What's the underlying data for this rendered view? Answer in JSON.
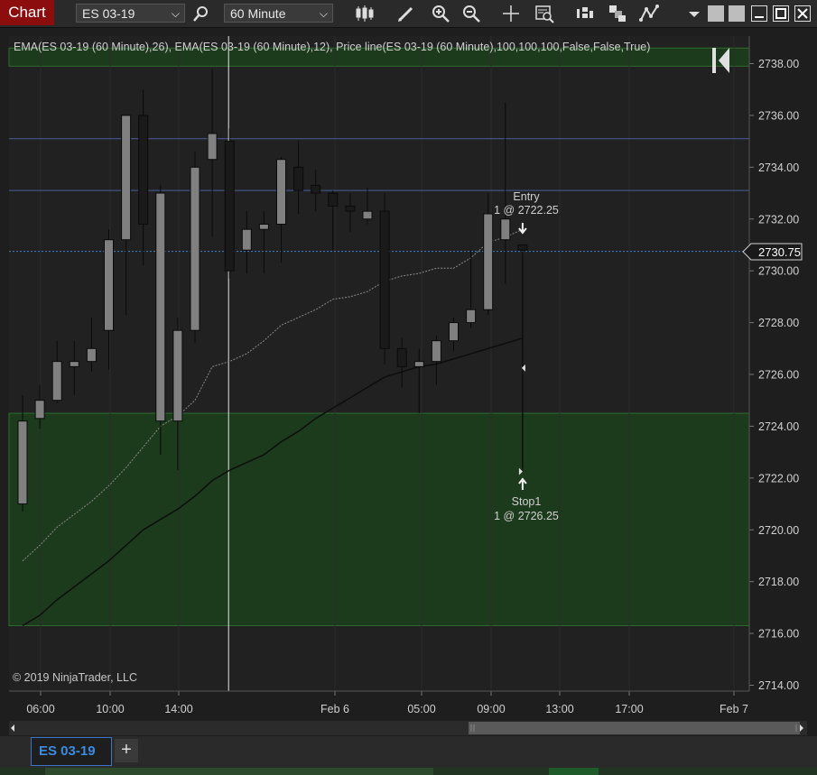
{
  "toolbar": {
    "title": "Chart",
    "instrument": "ES 03-19",
    "timeframe": "60 Minute"
  },
  "indicator_label": "EMA(ES 03-19 (60 Minute),26), EMA(ES 03-19 (60 Minute),12), Price line(ES 03-19 (60 Minute),100,100,100,False,False,True)",
  "copyright": "© 2019 NinjaTrader, LLC",
  "price_axis": {
    "ticks": [
      "2738.00",
      "2736.00",
      "2734.00",
      "2732.00",
      "2730.00",
      "2728.00",
      "2726.00",
      "2724.00",
      "2722.00",
      "2720.00",
      "2718.00",
      "2716.00",
      "2714.00"
    ],
    "current_price": "2730.75"
  },
  "time_axis": {
    "ticks": [
      "06:00",
      "10:00",
      "14:00",
      "Feb 6",
      "05:00",
      "09:00",
      "13:00",
      "17:00",
      "Feb 7"
    ]
  },
  "orders": {
    "entry_name": "Entry",
    "entry_detail": "1 @ 2722.25",
    "stop_name": "Stop1",
    "stop_detail": "1 @ 2726.25"
  },
  "tabs": {
    "active": "ES 03-19",
    "add": "+"
  },
  "colors": {
    "title_bg": "#8b0d0d",
    "up_candle": "#808080",
    "down_candle": "#1a1a1a",
    "zone": "#1c3a1c",
    "hline": "#4a5fa0",
    "price_line": "#3b82c4",
    "tab_accent": "#3b8be0"
  },
  "chart_data": {
    "type": "candlestick",
    "instrument": "ES 03-19",
    "interval": "60 Minute",
    "candles": [
      {
        "o": 2721.0,
        "h": 2725.2,
        "l": 2720.7,
        "c": 2724.2
      },
      {
        "o": 2724.3,
        "h": 2725.6,
        "l": 2723.9,
        "c": 2725.0
      },
      {
        "o": 2725.0,
        "h": 2727.3,
        "l": 2724.9,
        "c": 2726.5
      },
      {
        "o": 2726.3,
        "h": 2727.3,
        "l": 2725.2,
        "c": 2726.5
      },
      {
        "o": 2726.5,
        "h": 2728.2,
        "l": 2726.1,
        "c": 2727.0
      },
      {
        "o": 2727.7,
        "h": 2731.6,
        "l": 2726.2,
        "c": 2731.2
      },
      {
        "o": 2731.2,
        "h": 2736.0,
        "l": 2728.3,
        "c": 2736.0
      },
      {
        "o": 2736.0,
        "h": 2737.0,
        "l": 2730.2,
        "c": 2731.8
      },
      {
        "o": 2724.2,
        "h": 2733.3,
        "l": 2722.9,
        "c": 2733.0
      },
      {
        "o": 2724.2,
        "h": 2728.2,
        "l": 2722.3,
        "c": 2727.7
      },
      {
        "o": 2727.7,
        "h": 2734.6,
        "l": 2727.2,
        "c": 2734.0
      },
      {
        "o": 2734.3,
        "h": 2737.8,
        "l": 2731.3,
        "c": 2735.3
      },
      {
        "o": 2735.0,
        "h": 2735.5,
        "l": 2729.7,
        "c": 2730.0
      },
      {
        "o": 2730.8,
        "h": 2732.3,
        "l": 2729.9,
        "c": 2731.6
      },
      {
        "o": 2731.6,
        "h": 2732.3,
        "l": 2729.9,
        "c": 2731.8
      },
      {
        "o": 2731.8,
        "h": 2734.4,
        "l": 2730.3,
        "c": 2734.3
      },
      {
        "o": 2734.0,
        "h": 2735.0,
        "l": 2732.2,
        "c": 2733.1
      },
      {
        "o": 2733.3,
        "h": 2733.9,
        "l": 2732.3,
        "c": 2733.0
      },
      {
        "o": 2733.0,
        "h": 2733.1,
        "l": 2730.8,
        "c": 2732.5
      },
      {
        "o": 2732.5,
        "h": 2733.0,
        "l": 2731.5,
        "c": 2732.3
      },
      {
        "o": 2732.0,
        "h": 2733.2,
        "l": 2731.8,
        "c": 2732.3
      },
      {
        "o": 2732.3,
        "h": 2733.0,
        "l": 2726.4,
        "c": 2727.0
      },
      {
        "o": 2727.0,
        "h": 2727.4,
        "l": 2725.5,
        "c": 2726.3
      },
      {
        "o": 2726.3,
        "h": 2727.0,
        "l": 2724.5,
        "c": 2726.5
      },
      {
        "o": 2726.5,
        "h": 2727.5,
        "l": 2725.6,
        "c": 2727.3
      },
      {
        "o": 2727.3,
        "h": 2728.2,
        "l": 2726.9,
        "c": 2728.0
      },
      {
        "o": 2728.0,
        "h": 2730.8,
        "l": 2727.8,
        "c": 2728.5
      },
      {
        "o": 2728.5,
        "h": 2733.0,
        "l": 2728.3,
        "c": 2732.2
      },
      {
        "o": 2731.2,
        "h": 2736.5,
        "l": 2729.5,
        "c": 2732.0
      },
      {
        "o": 2731.0,
        "h": 2731.0,
        "l": 2722.3,
        "c": 2730.8
      }
    ],
    "ema26": [
      2716.3,
      2716.7,
      2717.3,
      2717.8,
      2718.3,
      2718.8,
      2719.4,
      2720.0,
      2720.4,
      2720.8,
      2721.3,
      2721.9,
      2722.3,
      2722.6,
      2722.9,
      2723.4,
      2723.8,
      2724.3,
      2724.7,
      2725.1,
      2725.5,
      2725.9,
      2726.1,
      2726.3,
      2726.4,
      2726.6,
      2726.8,
      2727.0,
      2727.2,
      2727.4
    ],
    "ema12": [
      2718.8,
      2719.4,
      2720.1,
      2720.6,
      2721.1,
      2721.7,
      2722.4,
      2723.2,
      2724.0,
      2724.4,
      2725.0,
      2726.3,
      2726.5,
      2726.8,
      2727.3,
      2727.9,
      2728.2,
      2728.5,
      2728.9,
      2729.0,
      2729.2,
      2729.6,
      2729.8,
      2729.9,
      2730.1,
      2730.1,
      2730.5,
      2731.1,
      2731.3,
      2731.6
    ],
    "price_axis_range": [
      2714.0,
      2738.5
    ],
    "horizontal_lines": [
      2735.1,
      2733.1
    ],
    "price_line": 2730.75,
    "zones": [
      {
        "from": 2716.3,
        "to": 2724.5
      },
      {
        "from": 2737.9,
        "to": 2739.0
      }
    ],
    "vertical_line_index": 12,
    "order_markers": [
      {
        "label": "Entry",
        "quantity": 1,
        "price": 2722.25,
        "candle_index": 29
      },
      {
        "label": "Stop1",
        "quantity": 1,
        "price": 2726.25,
        "candle_index": 29
      }
    ],
    "ylabel": "",
    "xlabel": "",
    "title": ""
  }
}
